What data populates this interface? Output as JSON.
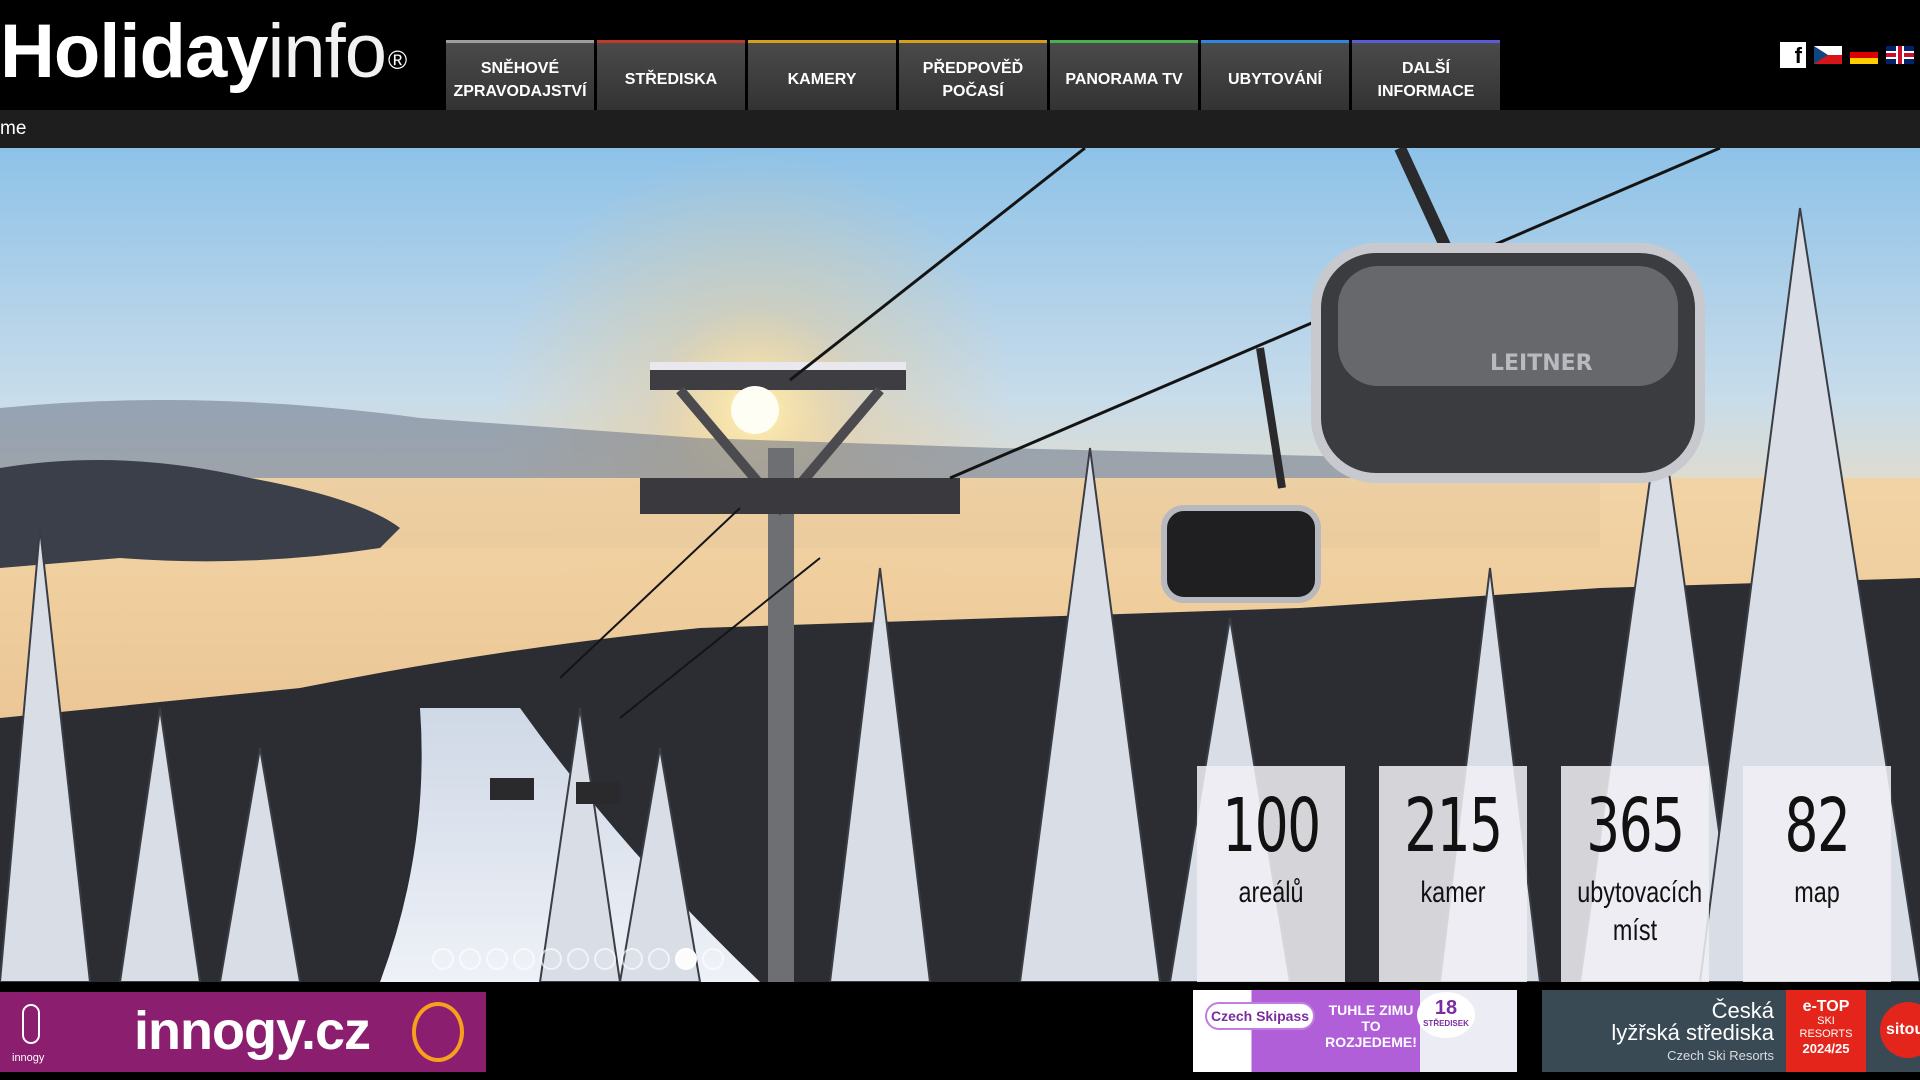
{
  "header": {
    "logo_bold": "Holiday",
    "logo_light": "info",
    "logo_mark": "®",
    "nav": [
      {
        "label_line1": "SNĚHOVÉ",
        "label_line2": "ZPRAVODAJSTVÍ",
        "accent": "#9e9e9e"
      },
      {
        "label_line1": "STŘEDISKA",
        "label_line2": "",
        "accent": "#c0392b"
      },
      {
        "label_line1": "KAMERY",
        "label_line2": "",
        "accent": "#d4a017"
      },
      {
        "label_line1": "PŘEDPOVĚĎ",
        "label_line2": "POČASÍ",
        "accent": "#d4a017"
      },
      {
        "label_line1": "PANORAMA TV",
        "label_line2": "",
        "accent": "#4caf50"
      },
      {
        "label_line1": "UBYTOVÁNÍ",
        "label_line2": "",
        "accent": "#2e86de"
      },
      {
        "label_line1": "DALŠÍ",
        "label_line2": "INFORMACE",
        "accent": "#5b5bd6"
      }
    ],
    "icons": [
      "facebook-icon",
      "flag-cz-icon",
      "flag-de-icon",
      "flag-en-icon"
    ],
    "facebook_glyph": "f"
  },
  "breadcrumb": {
    "text": "me"
  },
  "hero": {
    "stats": [
      {
        "number": "100",
        "label_line1": "areálů",
        "label_line2": ""
      },
      {
        "number": "215",
        "label_line1": "kamer",
        "label_line2": ""
      },
      {
        "number": "365",
        "label_line1": "ubytovacích",
        "label_line2": "míst"
      },
      {
        "number": "82",
        "label_line1": "map",
        "label_line2": ""
      }
    ],
    "lift_brand": "LEITNER",
    "slide_count": 11,
    "active_slide": 10
  },
  "banners": {
    "innogy": {
      "brand": "innogy.cz",
      "small": "innogy"
    },
    "skipass": {
      "logo": "Czech Skipass",
      "text": "TUHLE ZIMU TO ROZJEDEME!",
      "badge_number": "18",
      "badge_label": "STŘEDISEK"
    },
    "czech_ski": {
      "line1": "Česká",
      "line2": "lyžřská střediska",
      "sub": "Czech Ski Resorts",
      "etop_1": "e-TOP",
      "etop_2": "SKI",
      "etop_3": "RESORTS",
      "etop_4": "2024/25",
      "sitou": "sitou"
    }
  }
}
